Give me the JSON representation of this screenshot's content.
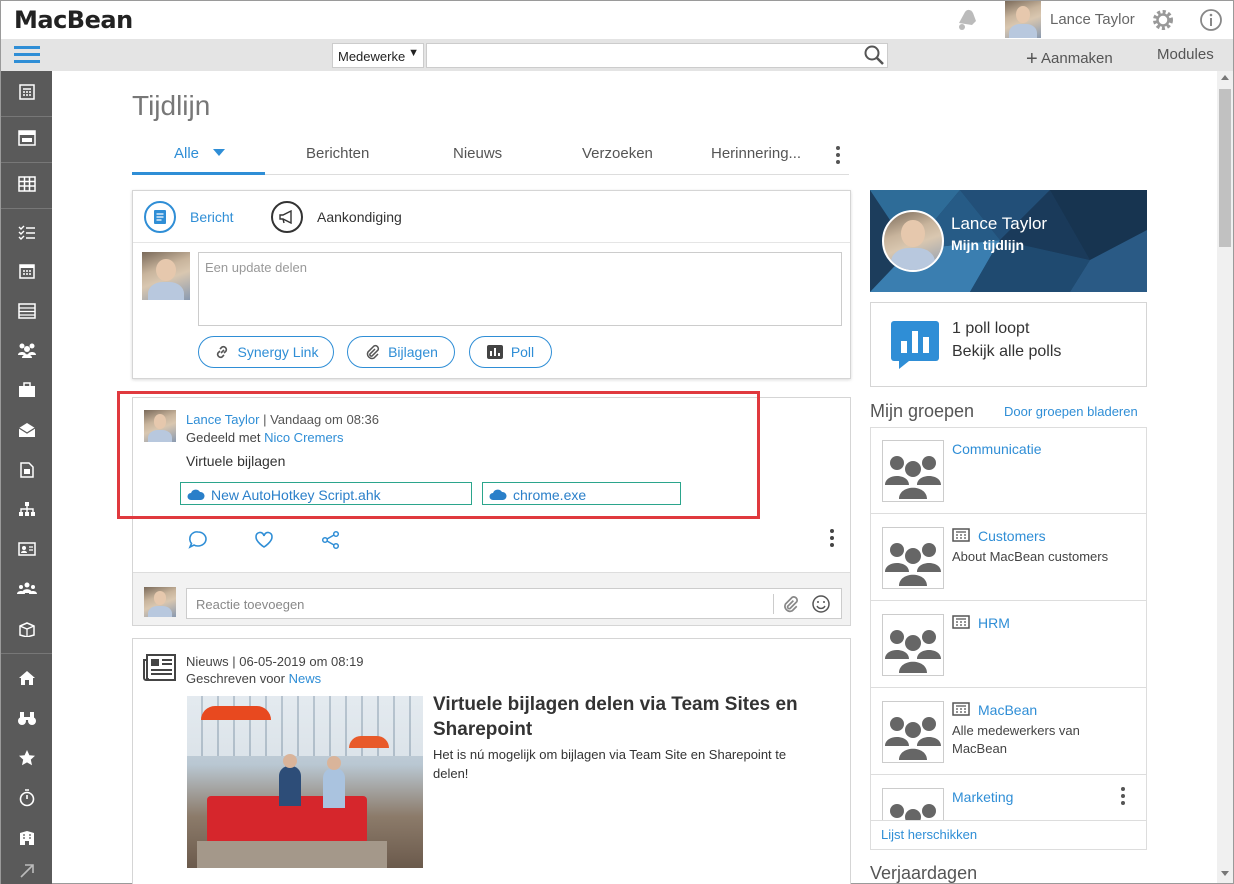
{
  "app": {
    "logo": "MacBean"
  },
  "header": {
    "user_name": "Lance Taylor"
  },
  "toolbar": {
    "search_scope": "Medewerke",
    "create_label": "Aanmaken",
    "modules_label": "Modules"
  },
  "page": {
    "title": "Tijdlijn"
  },
  "tabs": [
    {
      "label": "Alle"
    },
    {
      "label": "Berichten"
    },
    {
      "label": "Nieuws"
    },
    {
      "label": "Verzoeken"
    },
    {
      "label": "Herinnering..."
    }
  ],
  "composer": {
    "type_message": "Bericht",
    "type_announcement": "Aankondiging",
    "placeholder": "Een update delen",
    "buttons": {
      "link": "Synergy Link",
      "attachments": "Bijlagen",
      "poll": "Poll"
    }
  },
  "post": {
    "author": "Lance Taylor",
    "time": "| Vandaag om 08:36",
    "shared_prefix": "Gedeeld met",
    "shared_with": "Nico Cremers",
    "text": "Virtuele bijlagen",
    "attachments": [
      "New AutoHotkey Script.ahk",
      "chrome.exe"
    ],
    "comment_placeholder": "Reactie toevoegen"
  },
  "news": {
    "meta": "Nieuws | 06-05-2019 om 08:19",
    "written_prefix": "Geschreven voor",
    "written_for": "News",
    "title": "Virtuele bijlagen delen via Team Sites en Sharepoint",
    "body": "Het is nú mogelijk om bijlagen via Team Site en Sharepoint te delen!"
  },
  "profile_card": {
    "name": "Lance Taylor",
    "subtitle": "Mijn tijdlijn"
  },
  "polls": {
    "line1": "1 poll loopt",
    "line2": "Bekijk alle polls"
  },
  "groups": {
    "title": "Mijn groepen",
    "browse": "Door groepen bladeren",
    "items": [
      {
        "name": "Communicatie",
        "desc": ""
      },
      {
        "name": "Customers",
        "desc": "About MacBean customers"
      },
      {
        "name": "HRM",
        "desc": ""
      },
      {
        "name": "MacBean",
        "desc": "Alle medewerkers van MacBean"
      },
      {
        "name": "Marketing",
        "desc": ""
      }
    ],
    "reorder": "Lijst herschikken"
  },
  "birthdays": {
    "title": "Verjaardagen"
  },
  "colors": {
    "accent": "#2f8ed6",
    "rail": "#5a5a5a",
    "highlight": "#e0393e",
    "attachment_border": "#2ba58c"
  }
}
